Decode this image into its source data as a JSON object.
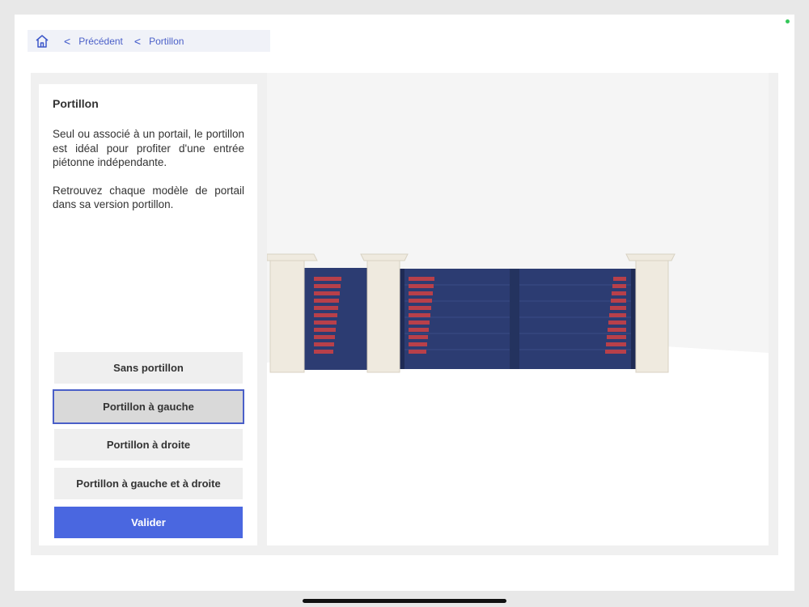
{
  "breadcrumb": {
    "back_label": "Précédent",
    "current_label": "Portillon"
  },
  "panel": {
    "title": "Portillon",
    "paragraph1": "Seul ou associé à un portail, le portillon est idéal pour profiter d'une entrée piétonne indépendante.",
    "paragraph2": "Retrouvez chaque modèle de portail dans sa version portillon."
  },
  "options": [
    {
      "label": "Sans portillon",
      "selected": false
    },
    {
      "label": "Portillon à gauche",
      "selected": true
    },
    {
      "label": "Portillon à droite",
      "selected": false
    },
    {
      "label": "Portillon à gauche et à droite",
      "selected": false
    }
  ],
  "validate_label": "Valider",
  "colors": {
    "accent": "#4a67e0",
    "gate": "#2c3c72",
    "slat_red": "#b8404a",
    "pillar": "#efeadf"
  }
}
